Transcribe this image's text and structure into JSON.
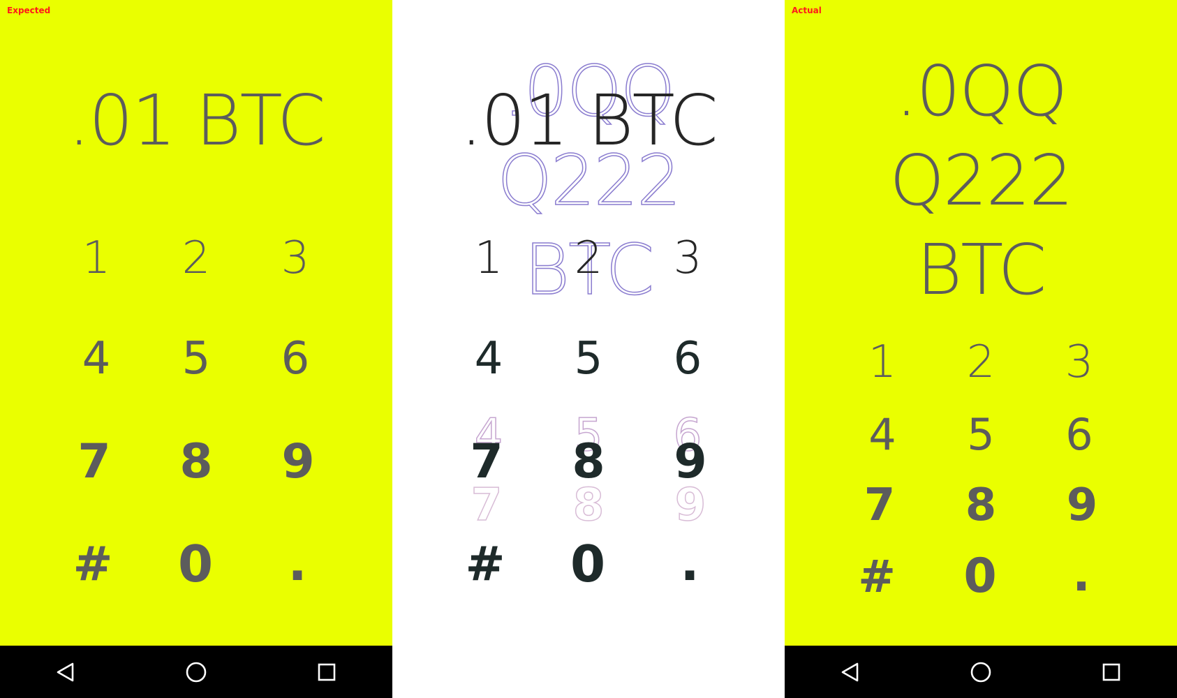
{
  "expected": {
    "caption": "Expected",
    "amount": ".01 BTC",
    "keys": [
      "1",
      "2",
      "3",
      "4",
      "5",
      "6",
      "7",
      "8",
      "9",
      "#",
      "0",
      "."
    ]
  },
  "actual": {
    "caption": "Actual",
    "amount_lines": [
      ".0QQ",
      "Q222",
      "BTC"
    ],
    "keys": [
      "1",
      "2",
      "3",
      "4",
      "5",
      "6",
      "7",
      "8",
      "9",
      "#",
      "0",
      "."
    ]
  },
  "colors": {
    "background": "#eaff00",
    "text": "#5c5c5c",
    "caption": "#ff1a1a",
    "navbar": "#000000"
  },
  "icons": {
    "back": "triangle-back-icon",
    "home": "circle-home-icon",
    "recents": "square-recents-icon"
  }
}
